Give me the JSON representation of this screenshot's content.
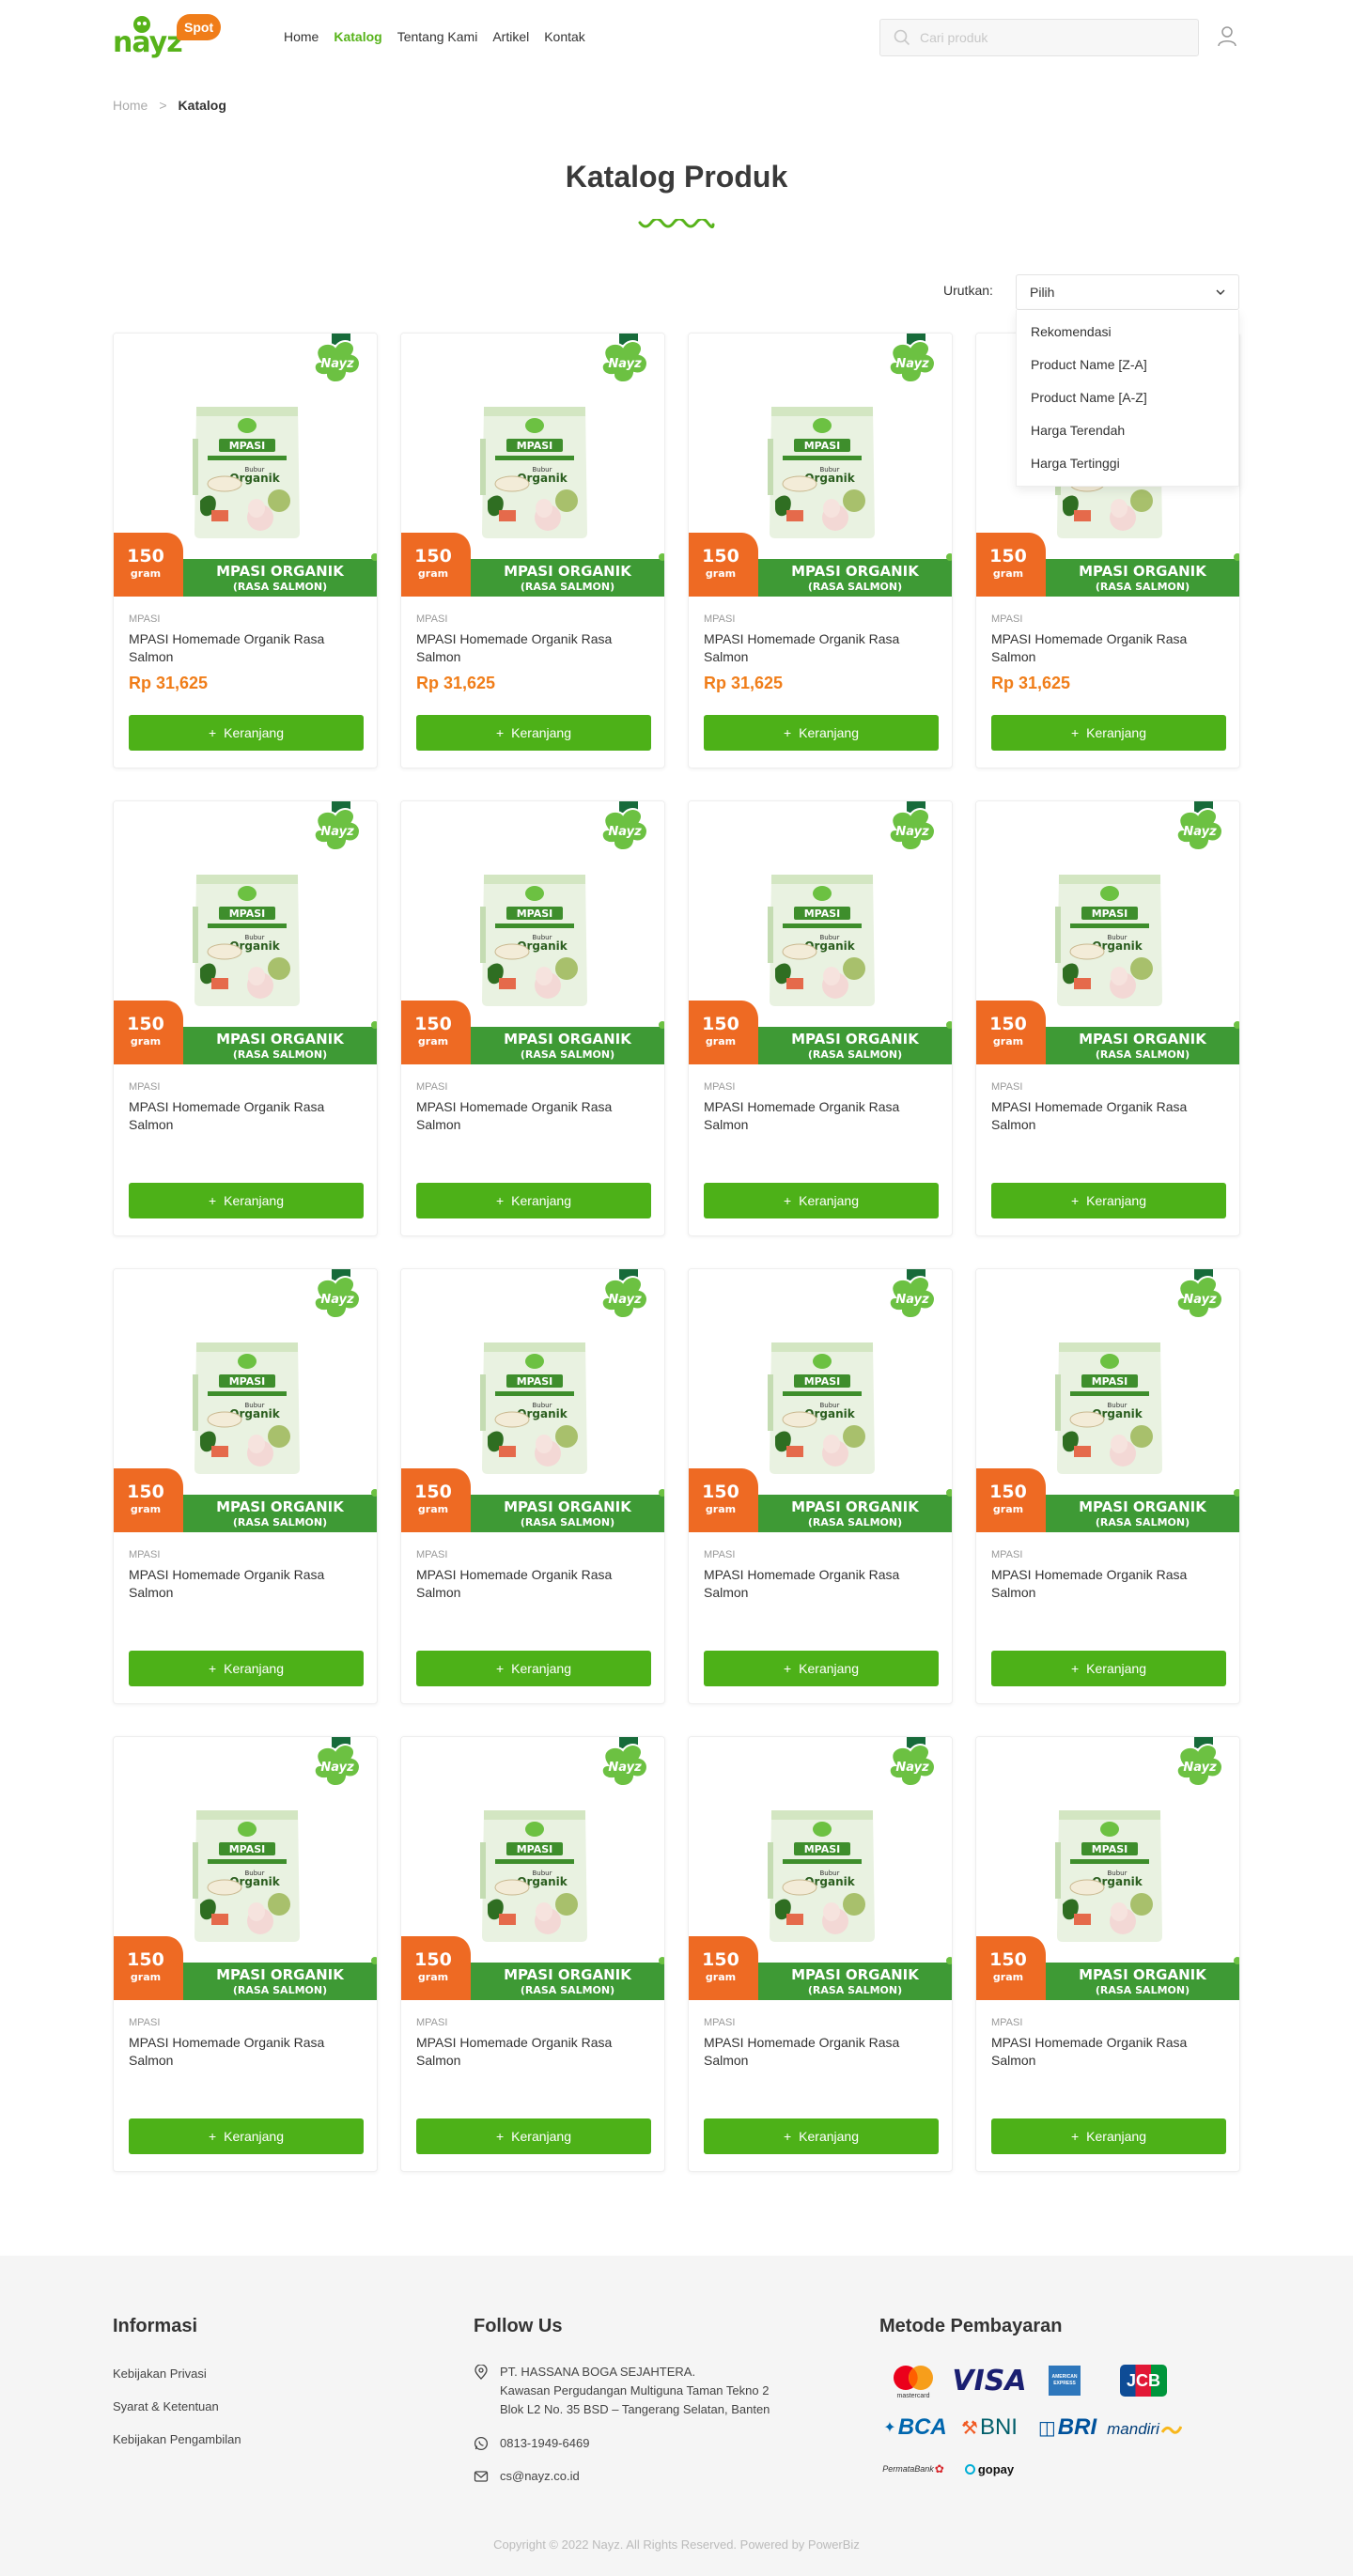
{
  "brand": {
    "logo_text": "nayz",
    "logo_badge": "Spot"
  },
  "nav": [
    {
      "label": "Home",
      "active": false
    },
    {
      "label": "Katalog",
      "active": true
    },
    {
      "label": "Tentang Kami",
      "active": false
    },
    {
      "label": "Artikel",
      "active": false
    },
    {
      "label": "Kontak",
      "active": false
    }
  ],
  "search": {
    "placeholder": "Cari produk"
  },
  "breadcrumb": {
    "home": "Home",
    "separator": ">",
    "current": "Katalog"
  },
  "page_title": "Katalog Produk",
  "sort": {
    "label": "Urutkan:",
    "selected": "Pilih",
    "options": [
      "Rekomendasi",
      "Product Name [Z-A]",
      "Product Name [A-Z]",
      "Harga Terendah",
      "Harga Tertinggi"
    ]
  },
  "product_image": {
    "weight_number": "150",
    "weight_unit": "gram",
    "banner_title": "MPASI ORGANIK",
    "banner_sub": "(RASA SALMON)",
    "pouch_label": "MPASI",
    "pouch_sub": "Bubur",
    "pouch_sub2": "Organik",
    "badge": "Nayz"
  },
  "products": [
    {
      "category": "MPASI",
      "name": "MPASI Homemade Organik Rasa Salmon",
      "price": "Rp 31,625",
      "button": "Keranjang"
    },
    {
      "category": "MPASI",
      "name": "MPASI Homemade Organik Rasa Salmon",
      "price": "Rp 31,625",
      "button": "Keranjang"
    },
    {
      "category": "MPASI",
      "name": "MPASI Homemade Organik Rasa Salmon",
      "price": "Rp 31,625",
      "button": "Keranjang"
    },
    {
      "category": "MPASI",
      "name": "MPASI Homemade Organik Rasa Salmon",
      "price": "Rp 31,625",
      "button": "Keranjang"
    },
    {
      "category": "MPASI",
      "name": "MPASI Homemade Organik Rasa Salmon",
      "price": "",
      "button": "Keranjang"
    },
    {
      "category": "MPASI",
      "name": "MPASI Homemade Organik Rasa Salmon",
      "price": "",
      "button": "Keranjang"
    },
    {
      "category": "MPASI",
      "name": "MPASI Homemade Organik Rasa Salmon",
      "price": "",
      "button": "Keranjang"
    },
    {
      "category": "MPASI",
      "name": "MPASI Homemade Organik Rasa Salmon",
      "price": "",
      "button": "Keranjang"
    },
    {
      "category": "MPASI",
      "name": "MPASI Homemade Organik Rasa Salmon",
      "price": "",
      "button": "Keranjang"
    },
    {
      "category": "MPASI",
      "name": "MPASI Homemade Organik Rasa Salmon",
      "price": "",
      "button": "Keranjang"
    },
    {
      "category": "MPASI",
      "name": "MPASI Homemade Organik Rasa Salmon",
      "price": "",
      "button": "Keranjang"
    },
    {
      "category": "MPASI",
      "name": "MPASI Homemade Organik Rasa Salmon",
      "price": "",
      "button": "Keranjang"
    },
    {
      "category": "MPASI",
      "name": "MPASI Homemade Organik Rasa Salmon",
      "price": "",
      "button": "Keranjang"
    },
    {
      "category": "MPASI",
      "name": "MPASI Homemade Organik Rasa Salmon",
      "price": "",
      "button": "Keranjang"
    },
    {
      "category": "MPASI",
      "name": "MPASI Homemade Organik Rasa Salmon",
      "price": "",
      "button": "Keranjang"
    },
    {
      "category": "MPASI",
      "name": "MPASI Homemade Organik Rasa Salmon",
      "price": "",
      "button": "Keranjang"
    }
  ],
  "footer": {
    "info_title": "Informasi",
    "info_links": [
      "Kebijakan Privasi",
      "Syarat & Ketentuan",
      "Kebijakan Pengambilan"
    ],
    "follow_title": "Follow Us",
    "address_line1": "PT. HASSANA BOGA SEJAHTERA.",
    "address_line2": "Kawasan Pergudangan Multiguna Taman Tekno 2",
    "address_line3": "Blok L2 No. 35 BSD – Tangerang Selatan, Banten",
    "phone": "0813-1949-6469",
    "email": "cs@nayz.co.id",
    "payment_title": "Metode Pembayaran",
    "payments": [
      "mastercard",
      "VISA",
      "AMERICAN EXPRESS",
      "JCB",
      "BCA",
      "BNI",
      "BRI",
      "mandiri",
      "PermataBank",
      "gopay"
    ],
    "copyright": "Copyright © 2022 Nayz. All Rights Reserved. Powered by PowerBiz"
  },
  "colors": {
    "brand_green": "#4db118",
    "brand_orange": "#f07d19",
    "banner_green": "#3e9a35"
  }
}
